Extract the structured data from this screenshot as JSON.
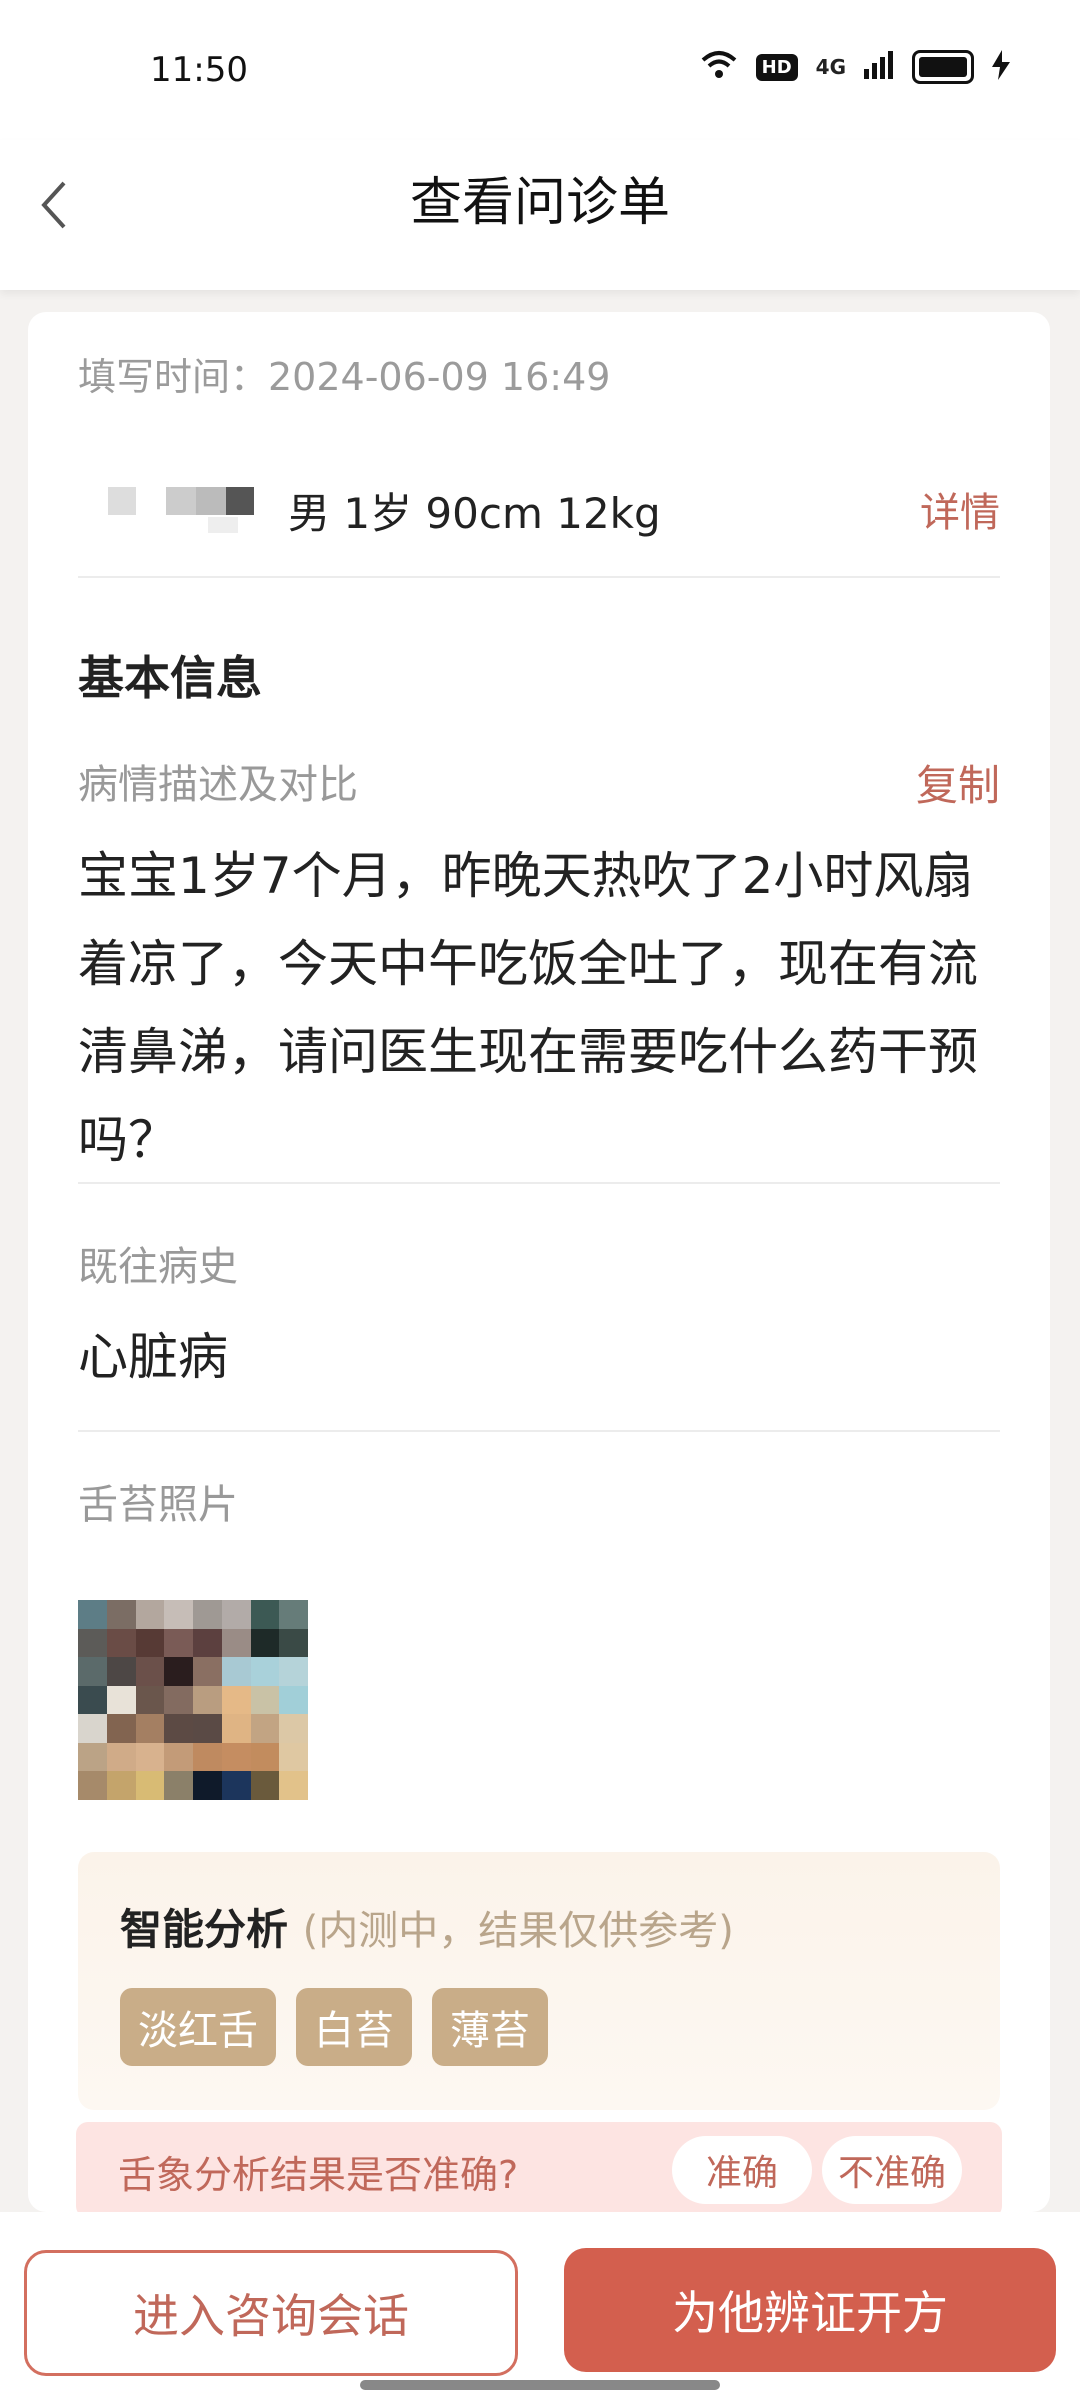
{
  "status_bar": {
    "time": "11:50",
    "hd": "HD",
    "network": "4G",
    "icons": [
      "wifi-icon",
      "hd-icon",
      "signal-4g-icon",
      "battery-icon",
      "charging-icon"
    ]
  },
  "nav": {
    "back_icon": "back-arrow-icon",
    "title": "查看问诊单"
  },
  "form": {
    "fill_time": "填写时间：2024-06-09 16:49",
    "patient_info": "男 1岁 90cm 12kg",
    "detail_label": "详情"
  },
  "basic_info": {
    "section_title": "基本信息",
    "desc_label": "病情描述及对比",
    "copy_label": "复制",
    "description": "宝宝1岁7个月，昨晚天热吹了2小时风扇着凉了，今天中午吃饭全吐了，现在有流清鼻涕，请问医生现在需要吃什么药干预吗？",
    "history_label": "既往病史",
    "history_value": "心脏病",
    "photo_label": "舌苔照片"
  },
  "analysis": {
    "title": "智能分析",
    "note": "(内测中，结果仅供参考)",
    "tags": [
      "淡红舌",
      "白苔",
      "薄苔"
    ]
  },
  "feedback": {
    "question": "舌象分析结果是否准确?",
    "accurate": "准确",
    "inaccurate": "不准确"
  },
  "actions": {
    "consult": "进入咨询会话",
    "prescribe": "为他辨证开方"
  },
  "colors": {
    "accent": "#c0685a",
    "primary_button": "#d35f4e",
    "tag_bg": "#c9ad88",
    "feedback_bg": "#fde4e2"
  }
}
